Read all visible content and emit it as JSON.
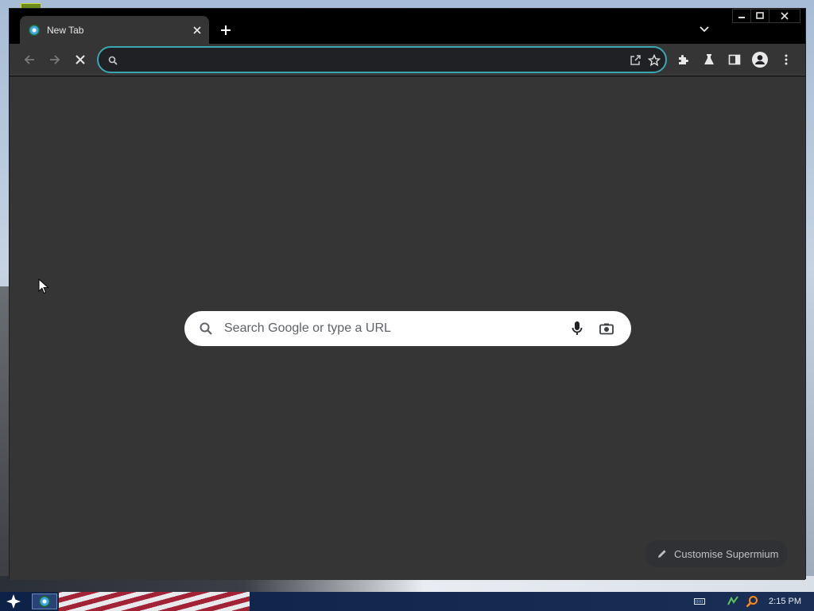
{
  "browser": {
    "tab": {
      "title": "New Tab",
      "favicon": "supermium-icon"
    },
    "new_tab_label": "+",
    "toolbar": {
      "back_icon": "arrow-left-icon",
      "forward_icon": "arrow-right-icon",
      "stop_icon": "close-icon",
      "omnibox_value": "",
      "omnibox_placeholder": "",
      "share_icon": "share-icon",
      "bookmark_icon": "star-icon",
      "extensions_icon": "puzzle-icon",
      "labs_icon": "flask-icon",
      "sidepanel_icon": "side-panel-icon",
      "profile_icon": "avatar-icon",
      "menu_icon": "kebab-menu-icon"
    },
    "accent_color": "#3ba7b3"
  },
  "new_tab_page": {
    "search_placeholder": "Search Google or type a URL",
    "voice_icon": "microphone-icon",
    "lens_icon": "camera-icon",
    "customise_label": "Customise Supermium"
  },
  "taskbar": {
    "clock": "2:15 PM",
    "tray_icons": [
      "keyboard-icon",
      "network-icon",
      "search-icon"
    ]
  }
}
